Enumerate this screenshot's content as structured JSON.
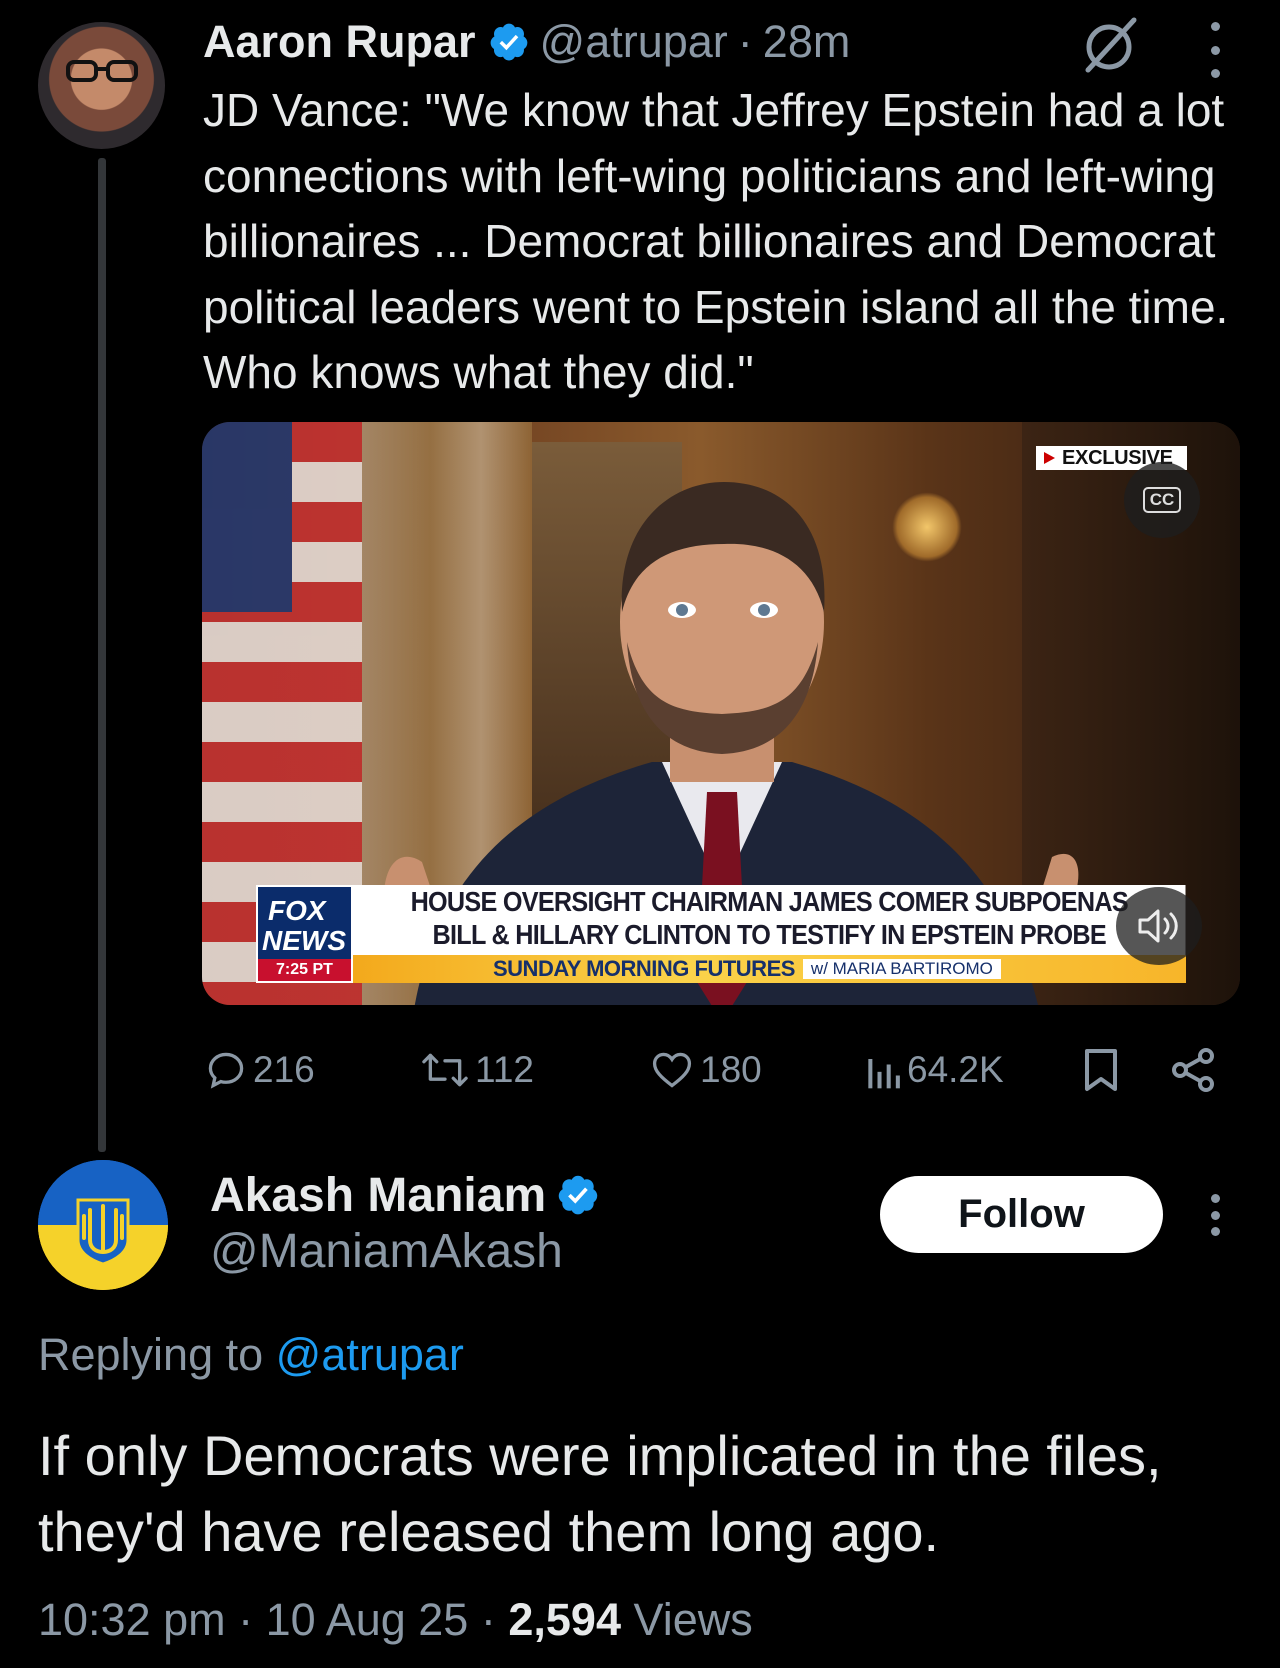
{
  "original_tweet": {
    "author_name": "Aaron Rupar",
    "handle": "@atrupar",
    "time_ago": "28m",
    "text": "JD Vance: \"We know that Jeffrey Epstein had a lot connections with left-wing politicians and left-wing billionaires ... Democrat billionaires and Democrat political leaders went to Epstein island all the time. Who knows what they did.\"",
    "video": {
      "exclusive_label": "EXCLUSIVE",
      "cc_label": "CC",
      "network_logo_line1": "FOX",
      "network_logo_line2": "NEWS",
      "clock": "7:25 PT",
      "chyron_line1": "HOUSE OVERSIGHT CHAIRMAN JAMES COMER SUBPOENAS",
      "chyron_line2": "BILL & HILLARY CLINTON TO TESTIFY IN EPSTEIN PROBE",
      "show_name": "SUNDAY MORNING FUTURES",
      "show_host": "w/ MARIA BARTIROMO"
    },
    "stats": {
      "replies": "216",
      "reposts": "112",
      "likes": "180",
      "views": "64.2K"
    }
  },
  "reply_tweet": {
    "author_name": "Akash Maniam",
    "handle": "@ManiamAkash",
    "follow_label": "Follow",
    "replying_prefix": "Replying to",
    "replying_to": "@atrupar",
    "text": "If only Democrats were implicated in the files, they'd have released them long ago.",
    "time": "10:32 pm",
    "date": "10 Aug 25",
    "views_count": "2,594",
    "views_label": "Views"
  },
  "icons": [
    "verified-badge-icon",
    "grok-icon",
    "more-icon",
    "reply-icon",
    "repost-icon",
    "like-icon",
    "views-icon",
    "bookmark-icon",
    "share-icon",
    "cc-icon",
    "sound-icon"
  ],
  "colors": {
    "background": "#000000",
    "text": "#e7e9ea",
    "secondary": "#8b98a5",
    "link": "#1d9bf0",
    "verified": "#1d9bf0"
  }
}
